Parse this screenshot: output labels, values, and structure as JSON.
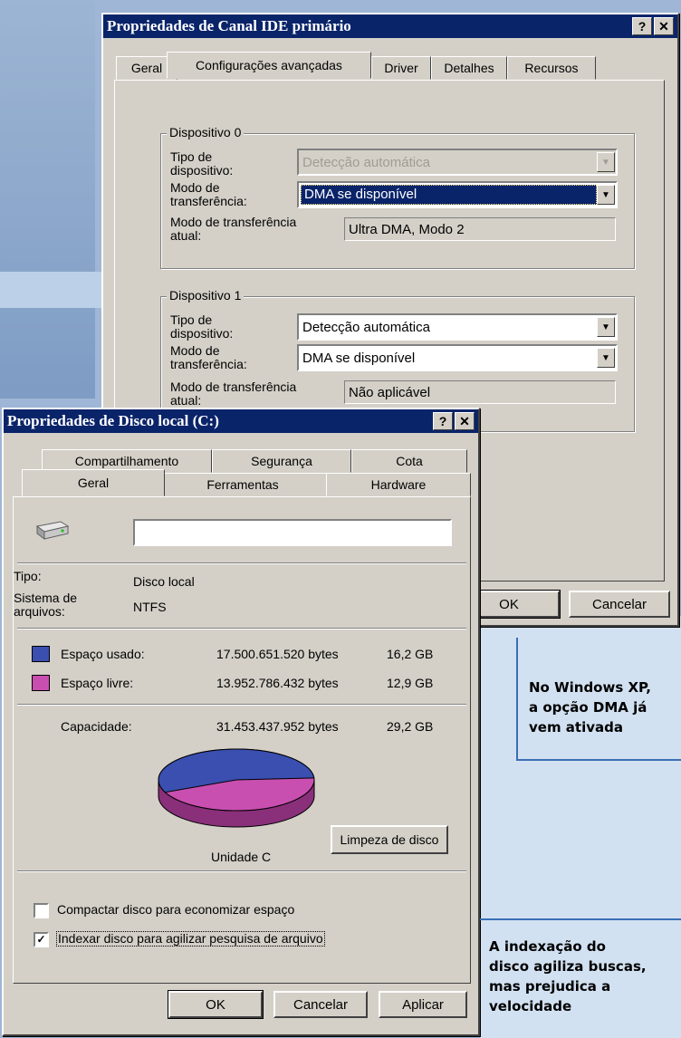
{
  "ide_dialog": {
    "title": "Propriedades de Canal IDE primário",
    "help_btn": "?",
    "close_btn": "✕",
    "tabs": [
      "Geral",
      "Configurações avançadas",
      "Driver",
      "Detalhes",
      "Recursos"
    ],
    "device0": {
      "title": "Dispositivo 0",
      "type_label_1": "Tipo de",
      "type_label_2": "dispositivo:",
      "type_value": "Detecção automática",
      "mode_label_1": "Modo de",
      "mode_label_2": "transferência:",
      "mode_value": "DMA se disponível",
      "current_label_1": "Modo de transferência",
      "current_label_2": "atual:",
      "current_value": "Ultra DMA, Modo 2"
    },
    "device1": {
      "title": "Dispositivo 1",
      "type_label_1": "Tipo de",
      "type_label_2": "dispositivo:",
      "type_value": "Detecção automática",
      "mode_label_1": "Modo de",
      "mode_label_2": "transferência:",
      "mode_value": "DMA se disponível",
      "current_label_1": "Modo de transferência",
      "current_label_2": "atual:",
      "current_value": "Não aplicável"
    },
    "ok_btn": "OK",
    "cancel_btn": "Cancelar"
  },
  "disk_dialog": {
    "title": "Propriedades de Disco local (C:)",
    "help_btn": "?",
    "close_btn": "✕",
    "tabs_row1": [
      "Compartilhamento",
      "Segurança",
      "Cota"
    ],
    "tabs_row2": [
      "Geral",
      "Ferramentas",
      "Hardware"
    ],
    "name_value": "",
    "type_label": "Tipo:",
    "type_value": "Disco local",
    "fs_label_1": "Sistema de",
    "fs_label_2": "arquivos:",
    "fs_value": "NTFS",
    "used_label": "Espaço usado:",
    "used_bytes": "17.500.651.520 bytes",
    "used_gb": "16,2 GB",
    "free_label": "Espaço livre:",
    "free_bytes": "13.952.786.432 bytes",
    "free_gb": "12,9 GB",
    "capacity_label": "Capacidade:",
    "capacity_bytes": "31.453.437.952 bytes",
    "capacity_gb": "29,2 GB",
    "used_fraction": 0.556,
    "drive_label": "Unidade C",
    "cleanup_btn": "Limpeza de disco",
    "compress_label": "Compactar disco para economizar espaço",
    "compress_checked": false,
    "index_label": "Indexar disco para agilizar pesquisa de arquivo",
    "index_checked": true,
    "ok_btn": "OK",
    "cancel_btn": "Cancelar",
    "apply_btn": "Aplicar"
  },
  "colors": {
    "used": "#3a4fb0",
    "free": "#c84fb0",
    "title_bar": "#0a246a"
  },
  "captions": {
    "dma_1": "No Windows XP,",
    "dma_2": "a opção DMA já",
    "dma_3": "vem ativada",
    "index_1": "A indexação do",
    "index_2": "disco agiliza buscas,",
    "index_3": "mas prejudica a",
    "index_4": "velocidade"
  }
}
